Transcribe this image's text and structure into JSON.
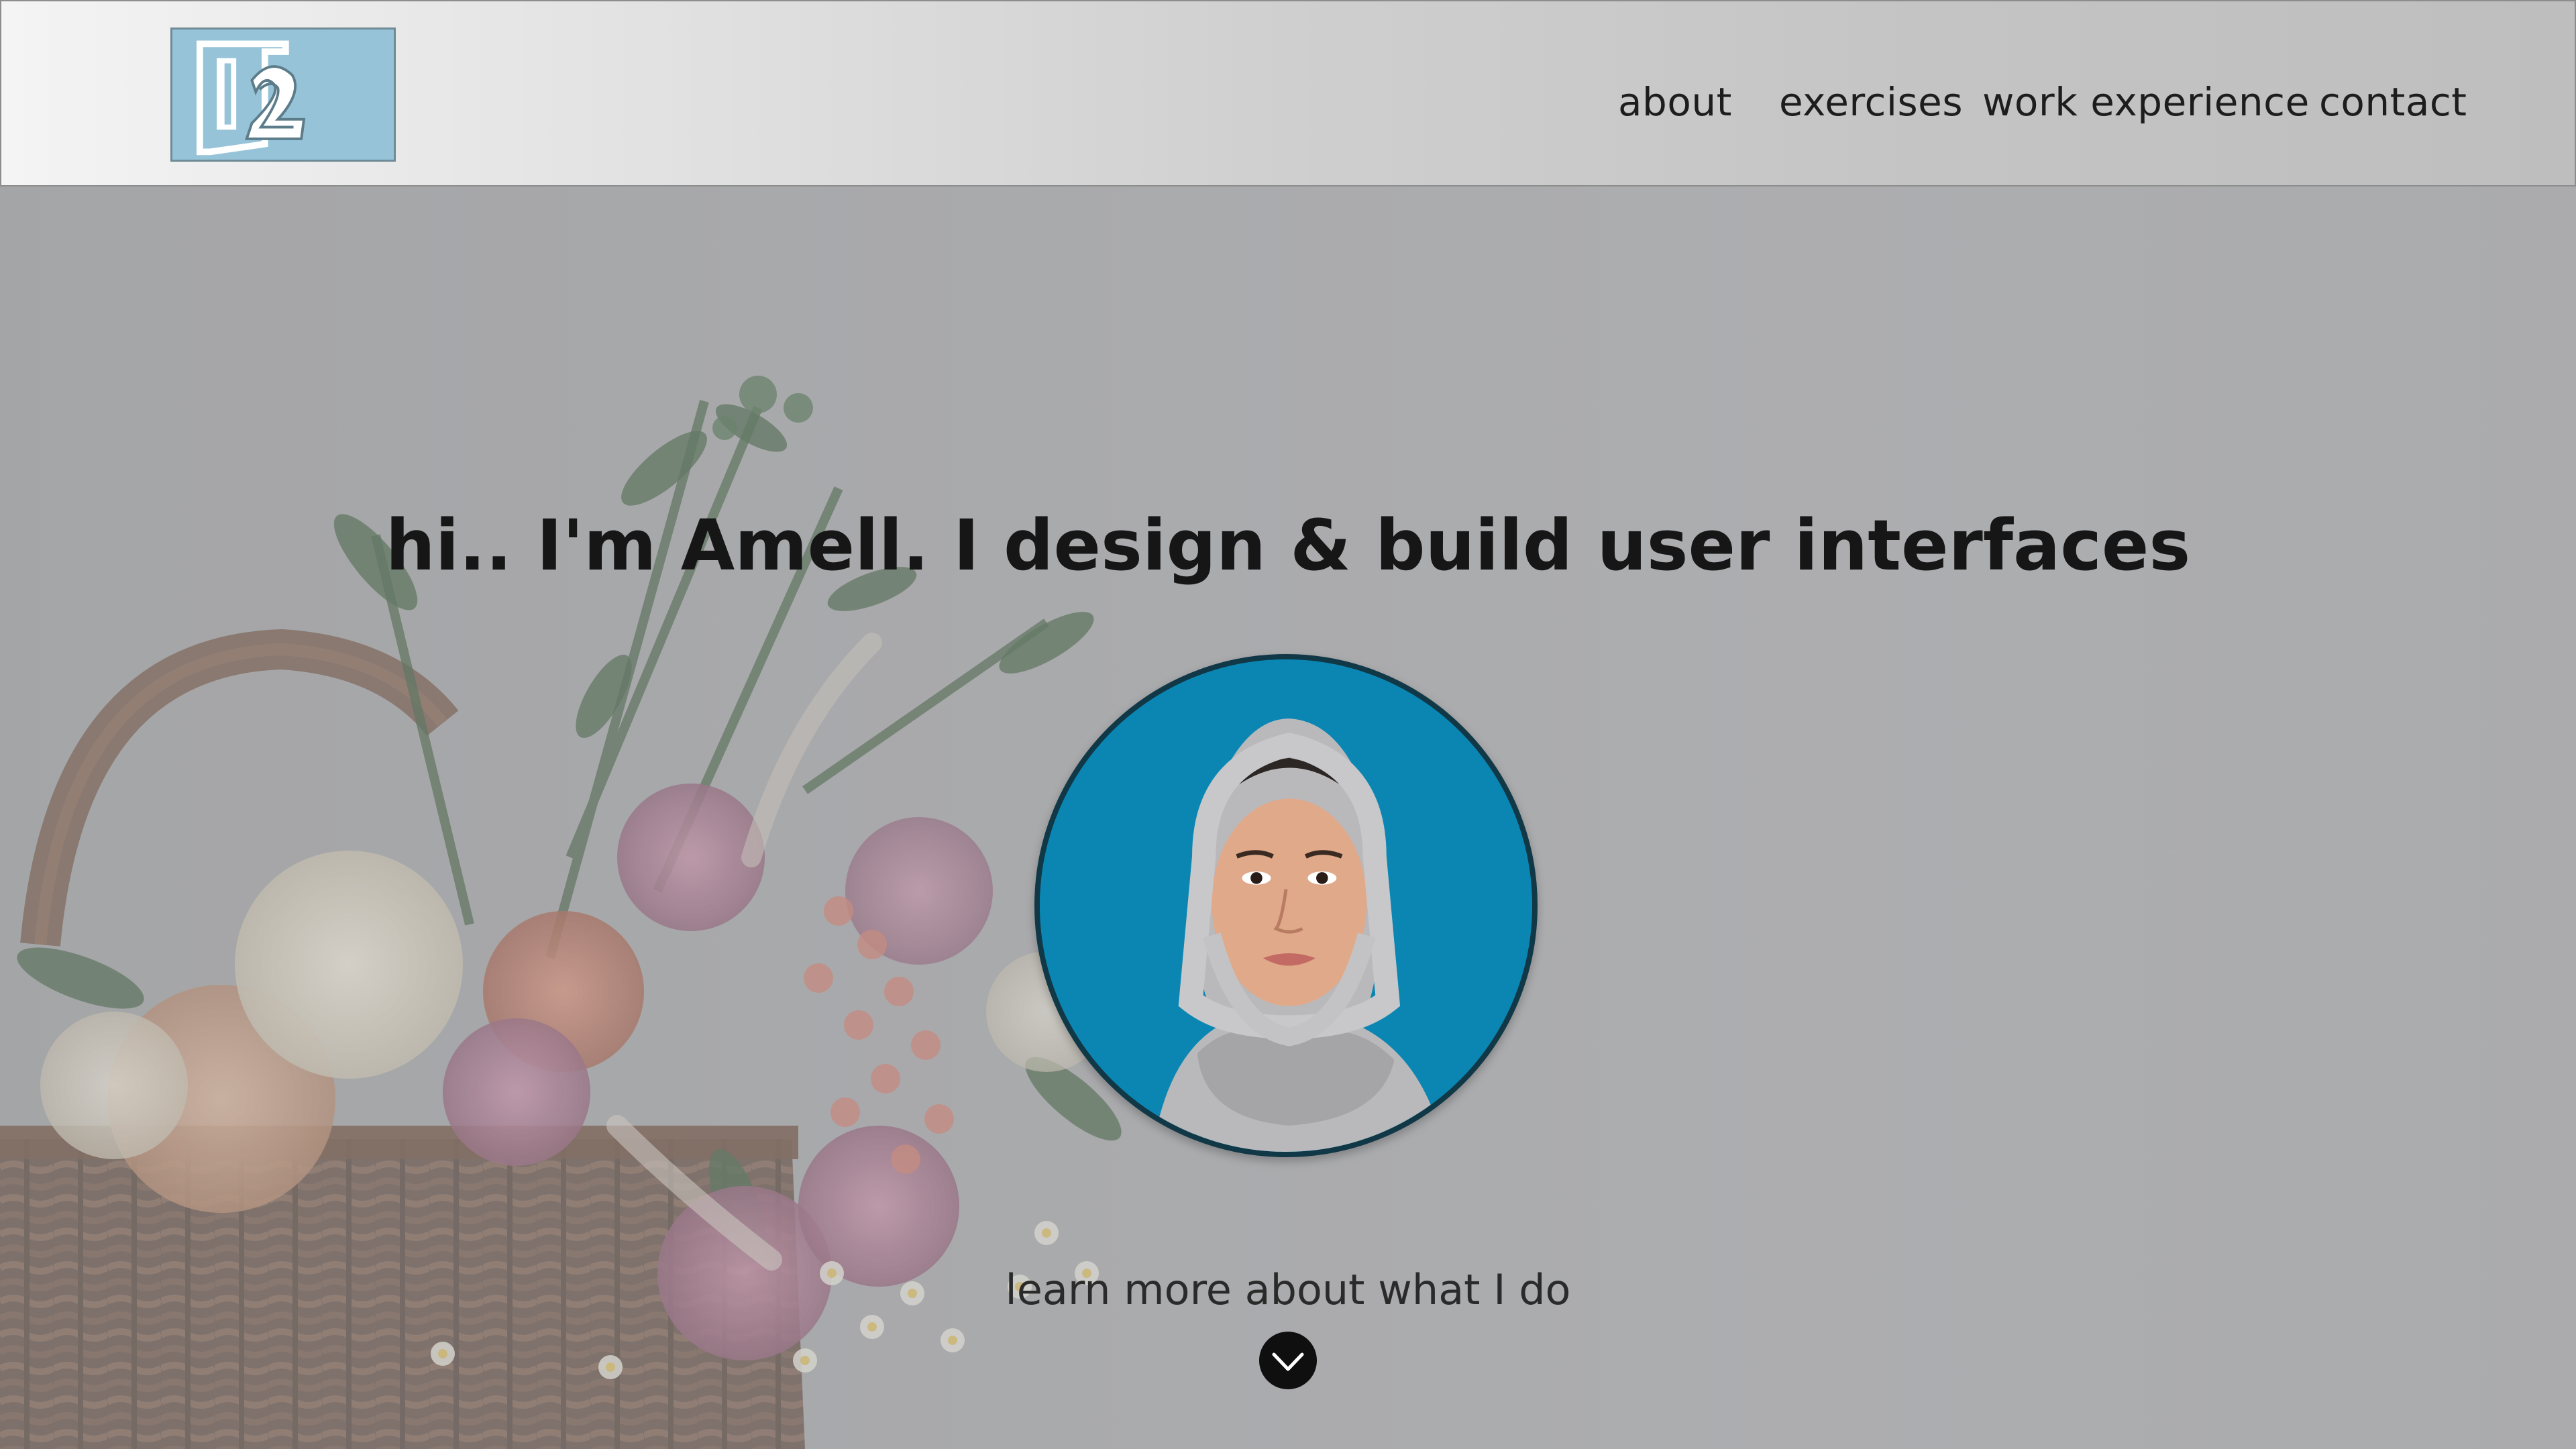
{
  "header": {
    "logo_icon": "l2-logo-icon",
    "nav": {
      "about": "about",
      "exercises": "exercises",
      "work_experience": "work experience",
      "contact": "contact"
    }
  },
  "hero": {
    "headline": "hi.. I'm Amell. I design & build user interfaces",
    "learn_more": "learn more about what I do",
    "scroll_icon": "chevron-down-icon"
  },
  "colors": {
    "logo_bg": "#96c3d8",
    "avatar_bg": "#0b86b3",
    "text": "#161616"
  }
}
